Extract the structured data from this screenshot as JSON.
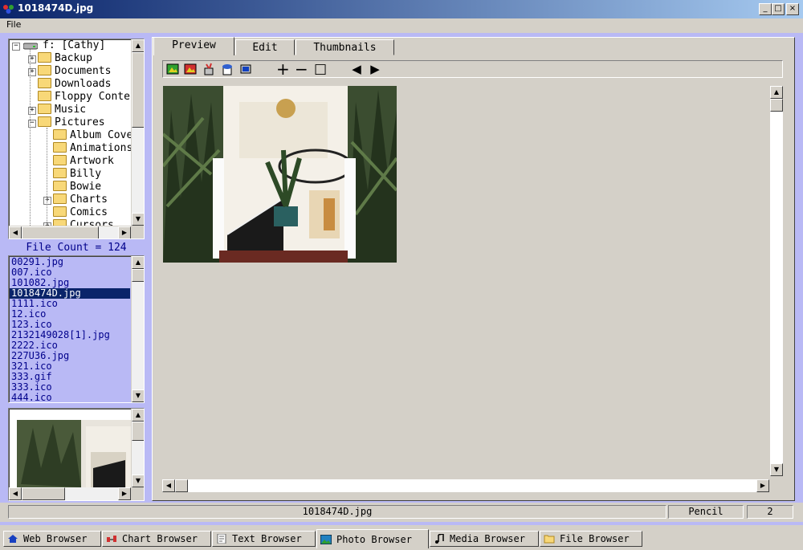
{
  "window": {
    "title": "1018474D.jpg",
    "buttons": {
      "minimize": "_",
      "maximize": "□",
      "close": "×"
    }
  },
  "menu": {
    "file": "File"
  },
  "tree": {
    "root": "f: [Cathy]",
    "items": [
      {
        "label": "Backup",
        "expander": "+"
      },
      {
        "label": "Documents",
        "expander": "+"
      },
      {
        "label": "Downloads",
        "expander": ""
      },
      {
        "label": "Floppy Conte",
        "expander": ""
      },
      {
        "label": "Music",
        "expander": "+"
      },
      {
        "label": "Pictures",
        "expander": "−"
      },
      {
        "label": "Album Cove",
        "expander": ""
      },
      {
        "label": "Animations",
        "expander": ""
      },
      {
        "label": "Artwork",
        "expander": ""
      },
      {
        "label": "Billy",
        "expander": ""
      },
      {
        "label": "Bowie",
        "expander": ""
      },
      {
        "label": "Charts",
        "expander": "+"
      },
      {
        "label": "Comics",
        "expander": ""
      },
      {
        "label": "Cursors",
        "expander": "+"
      }
    ]
  },
  "file_count": "File Count = 124",
  "files": [
    "00291.jpg",
    "007.ico",
    "101082.jpg",
    "1018474D.jpg",
    "1111.ico",
    "12.ico",
    "123.ico",
    "2132149028[1].jpg",
    "2222.ico",
    "227U36.jpg",
    "321.ico",
    "333.gif",
    "333.ico",
    "444.ico"
  ],
  "selected_file": "1018474D.jpg",
  "tabs": {
    "preview": "Preview",
    "edit": "Edit",
    "thumbnails": "Thumbnails"
  },
  "toolbar": {
    "plus": "+",
    "minus": "−",
    "fit": "□",
    "prev": "◀",
    "next": "▶"
  },
  "status": {
    "filename": "1018474D.jpg",
    "tool": "Pencil",
    "number": "2"
  },
  "bottom_tabs": [
    {
      "label": "Web Browser",
      "icon": "home-icon"
    },
    {
      "label": "Chart Browser",
      "icon": "chart-icon"
    },
    {
      "label": "Text Browser",
      "icon": "text-icon"
    },
    {
      "label": "Photo Browser",
      "icon": "photo-icon"
    },
    {
      "label": "Media Browser",
      "icon": "music-icon"
    },
    {
      "label": "File Browser",
      "icon": "folder-icon"
    }
  ],
  "colors": {
    "panel_bg": "#b9b9f5",
    "selection": "#0a246a",
    "file_text": "#00008b",
    "face": "#d4d0c8"
  }
}
